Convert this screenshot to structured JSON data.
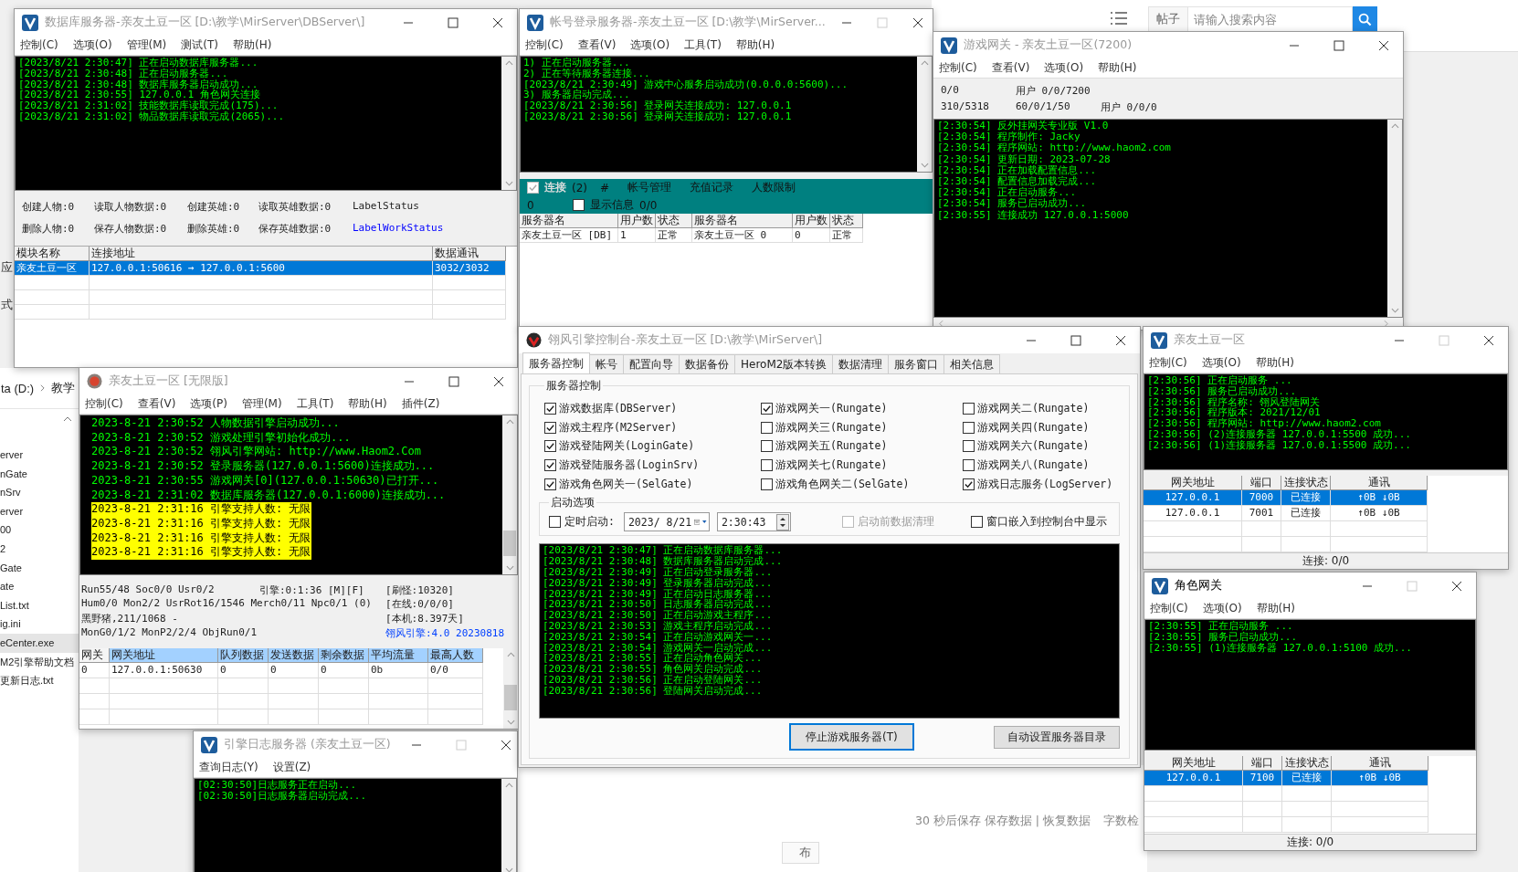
{
  "background": {
    "search": {
      "category": "帖子",
      "placeholder": "请输入搜索内容"
    },
    "explorer": {
      "breadcrumb": [
        "ta (D:)",
        "教学"
      ],
      "items": [
        {
          "label": "erver",
          "selected": false
        },
        {
          "label": "nGate",
          "selected": false
        },
        {
          "label": "nSrv",
          "selected": false
        },
        {
          "label": "erver",
          "selected": false
        },
        {
          "label": "00",
          "selected": false
        },
        {
          "label": "2",
          "selected": false
        },
        {
          "label": "Gate",
          "selected": false
        },
        {
          "label": "ate",
          "selected": false
        },
        {
          "label": "List.txt",
          "selected": false
        },
        {
          "label": "ig.ini",
          "selected": false
        },
        {
          "label": "eCenter.exe",
          "selected": true
        },
        {
          "label": "M2引擎帮助文档",
          "selected": false
        },
        {
          "label": "更新日志.txt",
          "selected": false
        }
      ]
    },
    "side_fragments": [
      "应",
      "式"
    ],
    "editor_status": "30 秒后保存 保存数据 | 恢复数据",
    "editor_extra": "字数检",
    "footer_button": "布"
  },
  "windows": [
    {
      "kind": "dbserver",
      "title": "数据库服务器-亲友土豆一区   [D:\\教学\\MirServer\\DBServer\\]",
      "active": false,
      "maximize_enabled": true,
      "menus": [
        "控制(C)",
        "选项(O)",
        "管理(M)",
        "测试(T)",
        "帮助(H)"
      ],
      "log": [
        "[2023/8/21 2:30:47] 正在启动数据库服务器...",
        "[2023/8/21 2:30:48] 正在启动服务器...",
        "[2023/8/21 2:30:48] 数据库服务器启动成功...",
        "[2023/8/21 2:30:55] 127.0.0.1 角色网关连接",
        "[2023/8/21 2:31:02] 技能数据库读取完成(175)...",
        "[2023/8/21 2:31:02] 物品数据库读取完成(2065)..."
      ],
      "stats": [
        [
          "创建人物:0",
          "读取人物数据:0",
          "创建英雄:0",
          "读取英雄数据:0",
          "LabelStatus"
        ],
        [
          "删除人物:0",
          "保存人物数据:0",
          "删除英雄:0",
          "保存英雄数据:0"
        ]
      ],
      "work_status": {
        "text": "LabelWorkStatus",
        "color": "#0000ff"
      },
      "table": {
        "columns": [
          "模块名称",
          "连接地址",
          "数据通讯"
        ],
        "rows": [
          {
            "cells": [
              "亲友土豆一区",
              "127.0.0.1:50616 → 127.0.0.1:5600",
              "3032/3032"
            ],
            "selected": true
          }
        ]
      }
    },
    {
      "kind": "loginsrv",
      "title": "帐号登录服务器-亲友土豆一区   [D:\\教学\\MirServer...",
      "active": false,
      "maximize_enabled": false,
      "menus": [
        "控制(C)",
        "查看(V)",
        "选项(O)",
        "工具(T)",
        "帮助(H)"
      ],
      "log": [
        "1) 正在启动服务器...",
        "2) 正在等待服务器连接...",
        "[2023/8/21 2:30:49] 游戏中心服务启动成功(0.0.0.0:5600)...",
        "3) 服务器启动完成...",
        "[2023/8/21 2:30:56] 登录网关连接成功: 127.0.0.1",
        "[2023/8/21 2:30:56] 登录网关连接成功: 127.0.0.1"
      ],
      "panel": {
        "connect": {
          "label": "连接",
          "checked": true
        },
        "count": "(2)",
        "hash": "#",
        "links": [
          "帐号管理",
          "充值记录",
          "人数限制"
        ],
        "value": "0",
        "show_info": {
          "label": "显示信息",
          "checked": false
        },
        "info_count": "0/0"
      },
      "table": {
        "columns": [
          "服务器名",
          "用户数",
          "状态",
          "服务器名",
          "用户数",
          "状态"
        ],
        "rows": [
          {
            "cells": [
              "亲友土豆一区 [DB]",
              "1",
              "正常",
              "亲友土豆一区 0",
              "0",
              "正常"
            ],
            "selected": false
          }
        ]
      }
    },
    {
      "kind": "gamegate",
      "title": "游戏网关 - 亲友土豆一区(7200)",
      "active": false,
      "maximize_enabled": true,
      "menus": [
        "控制(C)",
        "查看(V)",
        "选项(O)",
        "帮助(H)"
      ],
      "info": [
        [
          "0/0",
          "用户 0/0/7200"
        ],
        [
          "310/5318",
          "60/0/1/50",
          "用户 0/0/0"
        ]
      ],
      "log": [
        "[2:30:54] 反外挂网关专业版 V1.0",
        "[2:30:54] 程序制作: Jacky",
        "[2:30:54] 程序网站: http://www.haom2.com",
        "[2:30:54] 更新日期: 2023-07-28",
        "[2:30:54] 正在加载配置信息...",
        "[2:30:54] 配置信息加载完成...",
        "[2:30:54] 正在启动服务...",
        "[2:30:54] 服务已启动成功...",
        "[2:30:55] 连接成功 127.0.0.1:5000"
      ]
    },
    {
      "kind": "m2",
      "title": "亲友土豆一区 [无限版]",
      "active": false,
      "maximize_enabled": true,
      "menus": [
        "控制(C)",
        "查看(V)",
        "选项(P)",
        "管理(M)",
        "工具(T)",
        "帮助(H)",
        "插件(Z)"
      ],
      "log": [
        {
          "text": "2023-8-21 2:30:52 人物数据引擎启动成功...",
          "highlight": false
        },
        {
          "text": "2023-8-21 2:30:52 游戏处理引擎初始化成功...",
          "highlight": false
        },
        {
          "text": "2023-8-21 2:30:52 翎风引擎网站: http://www.Haom2.Com",
          "highlight": false
        },
        {
          "text": "2023-8-21 2:30:52 登录服务器(127.0.0.1:5600)连接成功...",
          "highlight": false
        },
        {
          "text": "2023-8-21 2:30:55 游戏网关[0](127.0.0.1:50630)已打开...",
          "highlight": false
        },
        {
          "text": "2023-8-21 2:31:02 数据库服务器(127.0.0.1:6000)连接成功...",
          "highlight": false
        },
        {
          "text": "2023-8-21 2:31:16 引擎支持人数: 无限",
          "highlight": true
        },
        {
          "text": "2023-8-21 2:31:16 引擎支持人数: 无限",
          "highlight": true
        },
        {
          "text": "2023-8-21 2:31:16 引擎支持人数: 无限",
          "highlight": true
        },
        {
          "text": "2023-8-21 2:31:16 引擎支持人数: 无限",
          "highlight": true
        }
      ],
      "status": [
        [
          "Run55/48 Soc0/0 Usr0/2",
          "引擎:0:1:36 [M][F]",
          "[刷怪:10320]"
        ],
        [
          "Hum0/0 Mon2/2 UsrRot16/1546 Merch0/11 Npc0/1 (0)",
          "[在线:0/0/0]"
        ],
        [
          "黑野猪,211/1068 -",
          "[本机:8.397天]"
        ],
        [
          "MonG0/1/2 MonP2/2/4 ObjRun0/1"
        ]
      ],
      "version": "翎风引擎:4.0 20230818",
      "table": {
        "columns": [
          "网关",
          "网关地址",
          "队列数据",
          "发送数据",
          "剩余数据",
          "平均流量",
          "最高人数"
        ],
        "rows": [
          {
            "cells": [
              "0",
              "127.0.0.1:50630",
              "0",
              "0",
              "0",
              "0b",
              "0/0"
            ],
            "selected": false
          }
        ]
      }
    },
    {
      "kind": "logserver",
      "title": "引擎日志服务器 (亲友土豆一区)",
      "active": false,
      "maximize_enabled": false,
      "menus": [
        "查询日志(Y)",
        "设置(Z)"
      ],
      "log": [
        "[02:30:50]日志服务正在启动...",
        "[02:30:50]日志服务器启动完成..."
      ]
    },
    {
      "kind": "console",
      "title": "翎风引擎控制台-亲友土豆一区 [D:\\教学\\MirServer\\]",
      "active": false,
      "maximize_enabled": true,
      "tabs": [
        {
          "label": "服务器控制",
          "selected": true
        },
        {
          "label": "帐号",
          "selected": false
        },
        {
          "label": "配置向导",
          "selected": false
        },
        {
          "label": "数据备份",
          "selected": false
        },
        {
          "label": "HeroM2版本转换",
          "selected": false
        },
        {
          "label": "数据清理",
          "selected": false
        },
        {
          "label": "服务窗口",
          "selected": false
        },
        {
          "label": "相关信息",
          "selected": false
        }
      ],
      "group": "服务器控制",
      "checks": [
        {
          "label": "游戏数据库(DBServer)",
          "checked": true
        },
        {
          "label": "游戏网关一(Rungate)",
          "checked": true
        },
        {
          "label": "游戏网关二(Rungate)",
          "checked": false
        },
        {
          "label": "游戏主程序(M2Server)",
          "checked": true
        },
        {
          "label": "游戏网关三(Rungate)",
          "checked": false
        },
        {
          "label": "游戏网关四(Rungate)",
          "checked": false
        },
        {
          "label": "游戏登陆网关(LoginGate)",
          "checked": true
        },
        {
          "label": "游戏网关五(Rungate)",
          "checked": false
        },
        {
          "label": "游戏网关六(Rungate)",
          "checked": false
        },
        {
          "label": "游戏登陆服务器(LoginSrv)",
          "checked": true
        },
        {
          "label": "游戏网关七(Rungate)",
          "checked": false
        },
        {
          "label": "游戏网关八(Rungate)",
          "checked": false
        },
        {
          "label": "游戏角色网关一(SelGate)",
          "checked": true
        },
        {
          "label": "游戏角色网关二(SelGate)",
          "checked": false
        },
        {
          "label": "游戏日志服务(LogServer)",
          "checked": true
        }
      ],
      "options": {
        "title": "启动选项",
        "timed": {
          "label": "定时启动:",
          "checked": false
        },
        "date": "2023/ 8/21",
        "time": "2:30:43",
        "pre_clean": {
          "label": "启动前数据清理",
          "checked": false,
          "disabled": true
        },
        "embed": {
          "label": "窗口嵌入到控制台中显示",
          "checked": false
        }
      },
      "log": [
        "[2023/8/21 2:30:47] 正在启动数据库服务器...",
        "[2023/8/21 2:30:48] 数据库服务器启动完成...",
        "[2023/8/21 2:30:49] 正在启动登录服务器...",
        "[2023/8/21 2:30:49] 登录服务器启动完成...",
        "[2023/8/21 2:30:49] 正在启动日志服务器...",
        "[2023/8/21 2:30:50] 日志服务器启动完成...",
        "[2023/8/21 2:30:50] 正在启动游戏主程序...",
        "[2023/8/21 2:30:53] 游戏主程序启动完成...",
        "[2023/8/21 2:30:54] 正在启动游戏网关一...",
        "[2023/8/21 2:30:54] 游戏网关一启动完成...",
        "[2023/8/21 2:30:55] 正在启动角色网关...",
        "[2023/8/21 2:30:55] 角色网关启动完成...",
        "[2023/8/21 2:30:56] 正在启动登陆网关...",
        "[2023/8/21 2:30:56] 登陆网关启动完成..."
      ],
      "buttons": [
        {
          "label": "停止游戏服务器(T)",
          "focused": true
        },
        {
          "label": "自动设置服务器目录",
          "focused": false
        }
      ]
    },
    {
      "kind": "loggate",
      "title": "亲友土豆一区",
      "active": false,
      "maximize_enabled": false,
      "menus": [
        "控制(C)",
        "选项(O)",
        "帮助(H)"
      ],
      "log": [
        "[2:30:56] 正在启动服务 ...",
        "[2:30:56] 服务已启动成功...",
        "[2:30:56] 程序名称: 翎风登陆网关",
        "[2:30:56] 程序版本: 2021/12/01",
        "[2:30:56] 程序网站: http://www.haom2.com",
        "[2:30:56] (2)连接服务器 127.0.0.1:5500 成功...",
        "[2:30:56] (1)连接服务器 127.0.0.1:5500 成功..."
      ],
      "table": {
        "columns": [
          "网关地址",
          "端口",
          "连接状态",
          "通讯"
        ],
        "rows": [
          {
            "cells": [
              "127.0.0.1",
              "7000",
              "已连接",
              "↑0B   ↓0B"
            ],
            "selected": true
          },
          {
            "cells": [
              "127.0.0.1",
              "7001",
              "已连接",
              "↑0B   ↓0B"
            ],
            "selected": false
          }
        ]
      },
      "status": "连接: 0/0"
    },
    {
      "kind": "selgate",
      "title": "角色网关",
      "active": true,
      "maximize_enabled": false,
      "menus": [
        "控制(C)",
        "选项(O)",
        "帮助(H)"
      ],
      "log": [
        "[2:30:55] 正在启动服务 ...",
        "[2:30:55] 服务已启动成功...",
        "[2:30:55] (1)连接服务器 127.0.0.1:5100 成功..."
      ],
      "table": {
        "columns": [
          "网关地址",
          "端口",
          "连接状态",
          "通讯"
        ],
        "rows": [
          {
            "cells": [
              "127.0.0.1",
              "7100",
              "已连接",
              "↑0B   ↓0B"
            ],
            "selected": true
          }
        ]
      },
      "status": "连接: 0/0"
    }
  ]
}
